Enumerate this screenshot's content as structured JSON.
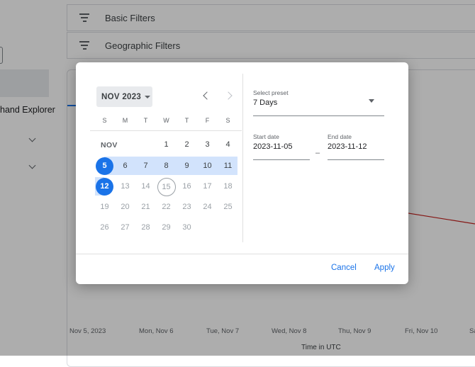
{
  "filters": {
    "basic": "Basic Filters",
    "geographic": "Geographic Filters"
  },
  "sidebar": {
    "text": "hand Explorer"
  },
  "chart": {
    "x_ticks": [
      "Nov 5, 2023",
      "Mon, Nov 6",
      "Tue, Nov 7",
      "Wed, Nov 8",
      "Thu, Nov 9",
      "Fri, Nov 10",
      "Sa"
    ],
    "x_title": "Time in UTC",
    "line_color": "#c5221f"
  },
  "calendar": {
    "month_button": "NOV 2023",
    "month_label": "NOV",
    "weekdays": [
      "S",
      "M",
      "T",
      "W",
      "T",
      "F",
      "S"
    ],
    "week1": [
      "1",
      "2",
      "3",
      "4"
    ],
    "week2": [
      "5",
      "6",
      "7",
      "8",
      "9",
      "10",
      "11"
    ],
    "week3": [
      "12",
      "13",
      "14",
      "15",
      "16",
      "17",
      "18"
    ],
    "week4": [
      "19",
      "20",
      "21",
      "22",
      "23",
      "24",
      "25"
    ],
    "week5": [
      "26",
      "27",
      "28",
      "29",
      "30"
    ]
  },
  "preset": {
    "label": "Select preset",
    "value": "7 Days"
  },
  "start_date": {
    "label": "Start date",
    "value": "2023-11-05"
  },
  "end_date": {
    "label": "End date",
    "value": "2023-11-12"
  },
  "range_separator": "–",
  "actions": {
    "cancel": "Cancel",
    "apply": "Apply"
  },
  "colors": {
    "accent": "#1a73e8",
    "range": "#d2e3fc"
  }
}
